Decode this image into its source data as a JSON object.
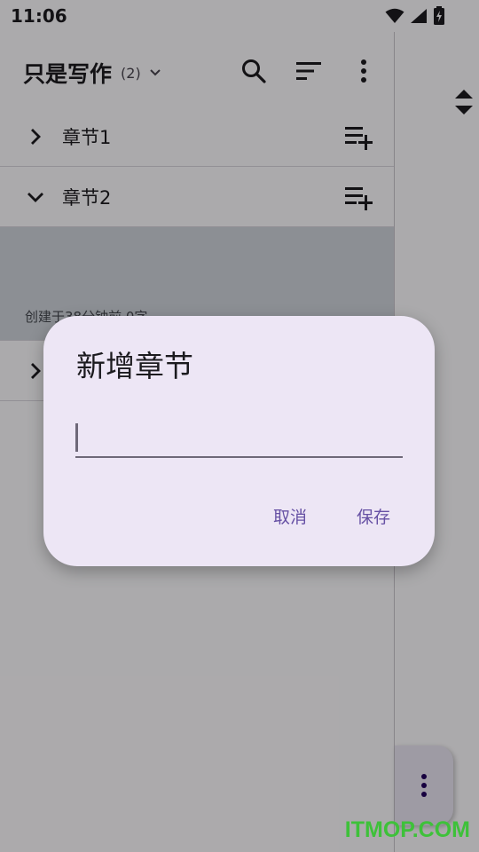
{
  "status_bar": {
    "time": "11:06",
    "icons": [
      "wifi-icon",
      "signal-icon",
      "battery-charging-icon"
    ]
  },
  "app_bar": {
    "title": "只是写作",
    "count": "(2)",
    "actions": [
      "search-icon",
      "sort-icon",
      "more-vert-icon"
    ]
  },
  "chapters": [
    {
      "label": "章节1",
      "expanded": false
    },
    {
      "label": "章节2",
      "expanded": true,
      "meta": "创建于38分钟前 0字"
    },
    {
      "label": "",
      "expanded": false
    }
  ],
  "dialog": {
    "title": "新增章节",
    "input_value": "",
    "cancel_label": "取消",
    "save_label": "保存"
  },
  "watermark": "ITMOP.COM",
  "colors": {
    "accent": "#6650a4",
    "dialog_bg": "#ede6f5",
    "scrim": "rgba(0,0,0,0.32)",
    "watermark": "#3ec13a"
  }
}
